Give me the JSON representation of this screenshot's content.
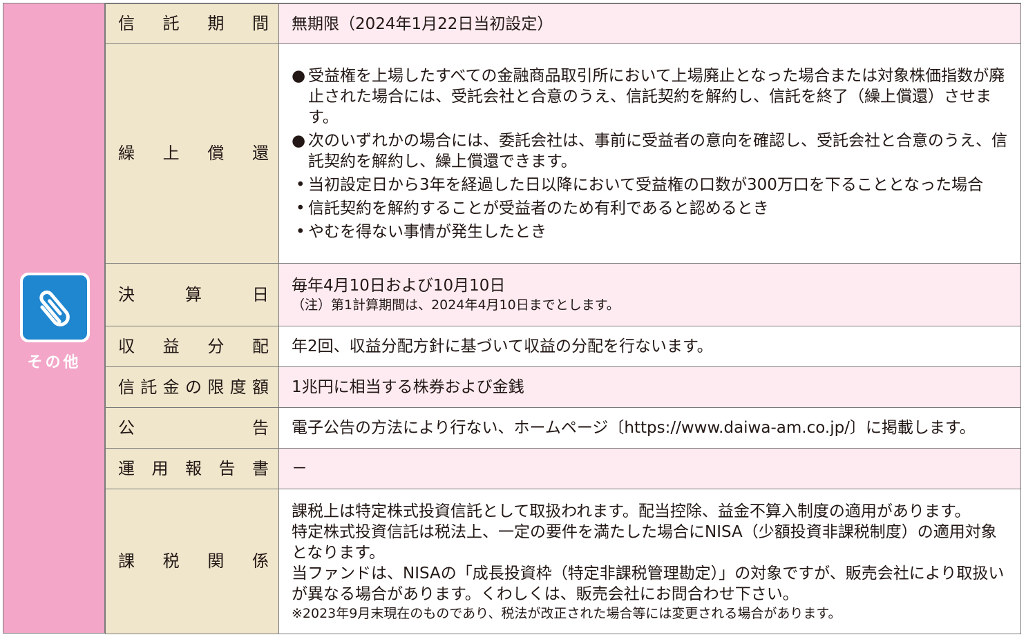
{
  "sidebar": {
    "label": "その他",
    "icon": "paperclip-icon"
  },
  "rows": [
    {
      "label": "信託期間",
      "value": "無期限（2024年1月22日当初設定）"
    },
    {
      "label": "繰上償還",
      "bullets": [
        "受益権を上場したすべての金融商品取引所において上場廃止となった場合または対象株価指数が廃止された場合には、受託会社と合意のうえ、信託契約を解約し、信託を終了（繰上償還）させます。",
        "次のいずれかの場合には、委託会社は、事前に受益者の意向を確認し、受託会社と合意のうえ、信託契約を解約し、繰上償還できます。"
      ],
      "subitems": [
        "当初設定日から3年を経過した日以降において受益権の口数が300万口を下ることとなった場合",
        "信託契約を解約することが受益者のため有利であると認めるとき",
        "やむを得ない事情が発生したとき"
      ]
    },
    {
      "label": "決算日",
      "value": "毎年4月10日および10月10日",
      "note": "（注）第1計算期間は、2024年4月10日までとします。"
    },
    {
      "label": "収益分配",
      "value": "年2回、収益分配方針に基づいて収益の分配を行ないます。"
    },
    {
      "label": "信託金の限度額",
      "value": "1兆円に相当する株券および金銭"
    },
    {
      "label": "公告",
      "value": "電子公告の方法により行ない、ホームページ〔https://www.daiwa-am.co.jp/〕に掲載します。"
    },
    {
      "label": "運用報告書",
      "value": "－"
    },
    {
      "label": "課税関係",
      "paragraphs": [
        "課税上は特定株式投資信託として取扱われます。配当控除、益金不算入制度の適用があります。",
        "特定株式投資信託は税法上、一定の要件を満たした場合にNISA（少額投資非課税制度）の適用対象となります。",
        "当ファンドは、NISAの「成長投資枠（特定非課税管理勘定）」の対象ですが、販売会社により取扱いが異なる場合があります。くわしくは、販売会社にお問合わせ下さい。"
      ],
      "note": "※2023年9月末現在のものであり、税法が改正された場合等には変更される場合があります。"
    }
  ],
  "colors": {
    "sidebar": "#f3a6c8",
    "label_bg": "#efe6cc",
    "value_pink": "#fdebf1",
    "icon_blue": "#1f86d0"
  }
}
